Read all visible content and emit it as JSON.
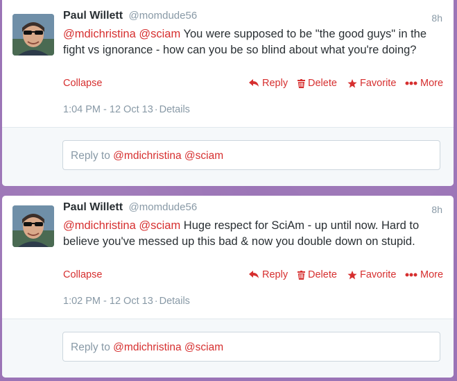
{
  "tweets": [
    {
      "name": "Paul Willett",
      "handle": "@momdude56",
      "time": "8h",
      "mention1": "@mdichristina",
      "mention2": "@sciam",
      "body": " You were supposed to be \"the good guys\" in the fight vs ignorance - how can you be so blind about what you're doing?",
      "collapse": "Collapse",
      "reply": "Reply",
      "delete": "Delete",
      "favorite": "Favorite",
      "more": "More",
      "timestamp": "1:04 PM - 12 Oct 13",
      "details": "Details",
      "reply_prefix": "Reply to ",
      "reply_mention1": "@mdichristina",
      "reply_mention2": "@sciam"
    },
    {
      "name": "Paul Willett",
      "handle": "@momdude56",
      "time": "8h",
      "mention1": "@mdichristina",
      "mention2": "@sciam",
      "body": " Huge respect for SciAm - up until now. Hard to believe you've messed up this bad & now you double down on stupid.",
      "collapse": "Collapse",
      "reply": "Reply",
      "delete": "Delete",
      "favorite": "Favorite",
      "more": "More",
      "timestamp": "1:02 PM - 12 Oct 13",
      "details": "Details",
      "reply_prefix": "Reply to ",
      "reply_mention1": "@mdichristina",
      "reply_mention2": "@sciam"
    }
  ],
  "colors": {
    "accent": "#d62f2f",
    "muted": "#8899a6",
    "background": "#9b74b6"
  }
}
